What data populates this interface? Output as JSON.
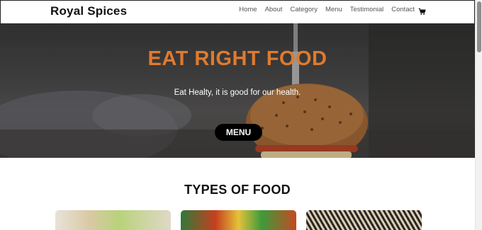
{
  "header": {
    "brand": "Royal Spices",
    "nav": [
      "Home",
      "About",
      "Category",
      "Menu",
      "Testimonial",
      "Contact"
    ],
    "cart_icon": "cart-icon"
  },
  "hero": {
    "title": "EAT RIGHT FOOD",
    "subtitle": "Eat Healty, it is good for our health.",
    "button_label": "MENU",
    "title_color": "#e07a2e"
  },
  "types": {
    "title": "TYPES OF FOOD",
    "cards": [
      {
        "name": "fruit-bowl-image"
      },
      {
        "name": "vegetables-image"
      },
      {
        "name": "grains-image"
      }
    ]
  }
}
